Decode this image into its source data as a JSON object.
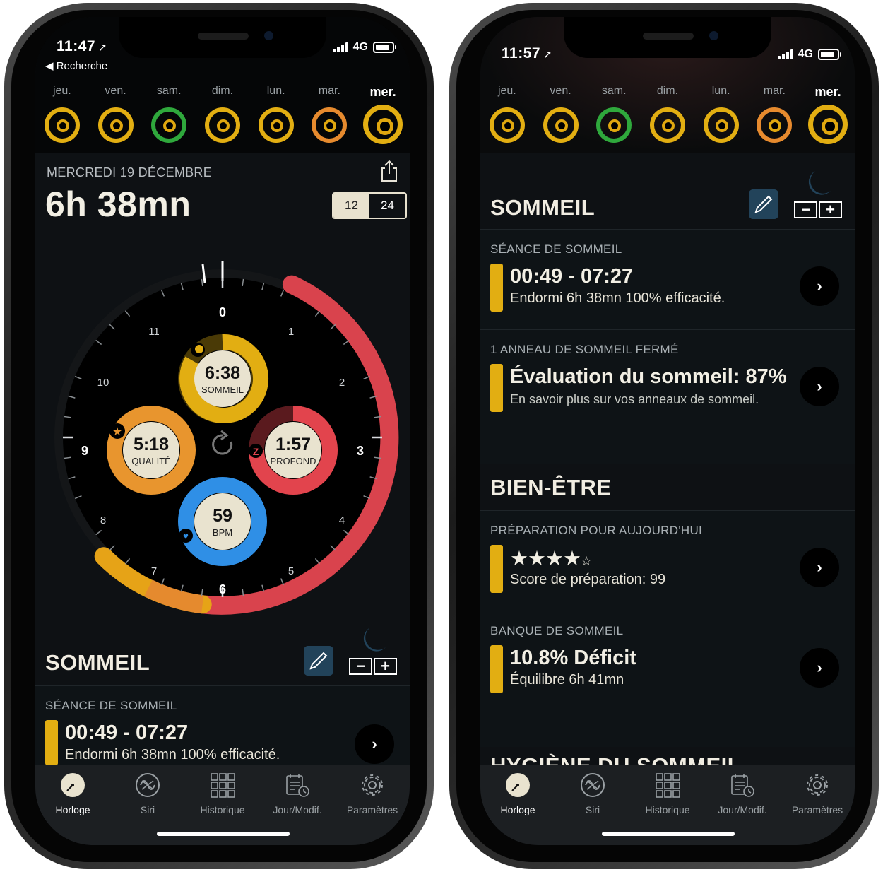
{
  "left": {
    "status": {
      "time": "11:47",
      "network": "4G",
      "back_label": "Recherche"
    },
    "days": [
      {
        "label": "jeu.",
        "ring": "#e2ae12"
      },
      {
        "label": "ven.",
        "ring": "#e2ae12"
      },
      {
        "label": "sam.",
        "ring": "#2fa83c"
      },
      {
        "label": "dim.",
        "ring": "#e2ae12"
      },
      {
        "label": "lun.",
        "ring": "#e2ae12"
      },
      {
        "label": "mar.",
        "ring": "#e68a2e"
      },
      {
        "label": "mer.",
        "ring": "#e2ae12",
        "today": true
      }
    ],
    "date_title": "MERCREDI 19 DÉCEMBRE",
    "total_duration": "6h 38mn",
    "format_toggle": {
      "option_12": "12",
      "option_24": "24",
      "selected": "12"
    },
    "clock": {
      "hours": [
        "0",
        "1",
        "2",
        "3",
        "4",
        "5",
        "6",
        "7",
        "8",
        "9",
        "10",
        "11"
      ],
      "gauges": [
        {
          "value": "6:38",
          "label": "SOMMEIL",
          "color": "#e2ae12",
          "icon": "moon-icon"
        },
        {
          "value": "5:18",
          "label": "QUALITÉ",
          "color": "#e8952e",
          "icon": "star-icon"
        },
        {
          "value": "1:57",
          "label": "PROFOND",
          "color": "#e2444d",
          "icon": "z-icon"
        },
        {
          "value": "59",
          "label": "BPM",
          "color": "#2f8fe6",
          "icon": "heart-icon"
        }
      ],
      "colors": {
        "asleep": "#d9434d",
        "light": "#e2ae12",
        "dial": "#000000"
      }
    },
    "section_title": "SOMMEIL",
    "session": {
      "caption": "SÉANCE DE SOMMEIL",
      "time_range": "00:49 - 07:27",
      "summary": "Endormi 6h 38mn 100% efficacité."
    }
  },
  "right": {
    "status": {
      "time": "11:57",
      "network": "4G"
    },
    "days": [
      {
        "label": "jeu.",
        "ring": "#e2ae12"
      },
      {
        "label": "ven.",
        "ring": "#e2ae12"
      },
      {
        "label": "sam.",
        "ring": "#2fa83c"
      },
      {
        "label": "dim.",
        "ring": "#e2ae12"
      },
      {
        "label": "lun.",
        "ring": "#e2ae12"
      },
      {
        "label": "mar.",
        "ring": "#e68a2e"
      },
      {
        "label": "mer.",
        "ring": "#e2ae12",
        "today": true
      }
    ],
    "section_sleep": "SOMMEIL",
    "session": {
      "caption": "SÉANCE DE SOMMEIL",
      "time_range": "00:49 - 07:27",
      "summary": "Endormi 6h 38mn 100% efficacité."
    },
    "rating": {
      "caption": "1 ANNEAU DE SOMMEIL FERMÉ",
      "title": "Évaluation du sommeil: 87%",
      "sub": "En savoir plus sur vos anneaux de sommeil."
    },
    "section_wellbeing": "BIEN-ÊTRE",
    "readiness": {
      "caption": "PRÉPARATION POUR AUJOURD'HUI",
      "stars_filled": 4,
      "stars_total": 5,
      "stars": "★★★★",
      "star_empty": "☆",
      "sub": "Score de préparation: 99"
    },
    "bank": {
      "caption": "BANQUE DE SOMMEIL",
      "title": "10.8% Déficit",
      "sub": "Équilibre 6h 41mn"
    },
    "next_section_partial": "HYGIÈNE DU SOMMEIL"
  },
  "tabs": [
    {
      "label": "Horloge",
      "icon": "clock-icon",
      "active": true
    },
    {
      "label": "Siri",
      "icon": "siri-icon",
      "active": false
    },
    {
      "label": "Historique",
      "icon": "grid-icon",
      "active": false
    },
    {
      "label": "Jour/Modif.",
      "icon": "calendar-edit-icon",
      "active": false
    },
    {
      "label": "Paramètres",
      "icon": "gear-icon",
      "active": false
    }
  ]
}
